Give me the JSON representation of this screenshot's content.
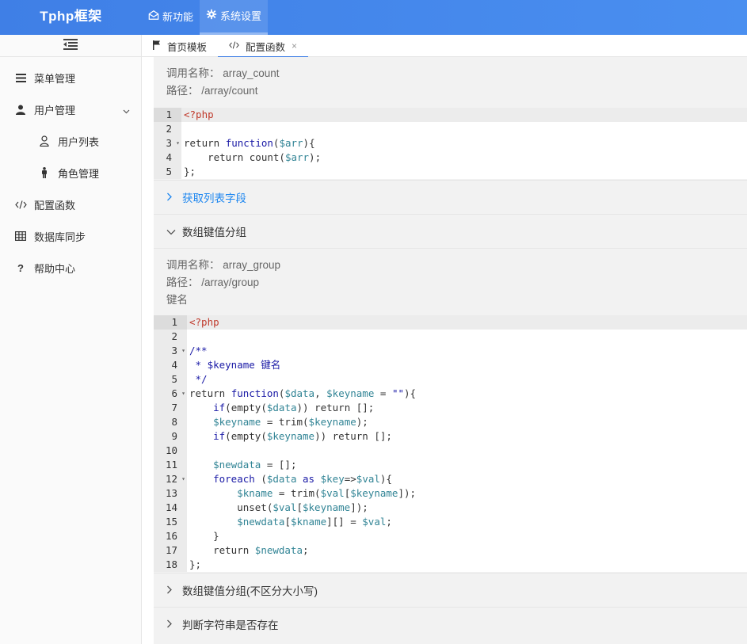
{
  "brand": "Tphp框架",
  "topnav": [
    {
      "label": "新功能",
      "icon": "envelope-open-icon"
    },
    {
      "label": "系统设置",
      "icon": "gear-icon"
    }
  ],
  "sidebar": {
    "items": [
      {
        "label": "菜单管理",
        "icon": "menu-lines-icon"
      },
      {
        "label": "用户管理",
        "icon": "user-icon"
      },
      {
        "label": "用户列表",
        "icon": "user-outline-icon"
      },
      {
        "label": "角色管理",
        "icon": "person-standing-icon"
      },
      {
        "label": "配置函数",
        "icon": "code-icon"
      },
      {
        "label": "数据库同步",
        "icon": "table-icon"
      },
      {
        "label": "帮助中心",
        "icon": "question-icon"
      }
    ]
  },
  "tabs": [
    {
      "label": "首页模板",
      "icon": "flag-icon"
    },
    {
      "label": "配置函数",
      "icon": "code-icon",
      "close": "×"
    }
  ],
  "block1": {
    "call_label": "调用名称：",
    "call_name": "array_count",
    "path_label": "路径：",
    "path": "/array/count"
  },
  "sections": {
    "s1": "获取列表字段",
    "s2": "数组键值分组",
    "s3": "数组键值分组(不区分大小写)",
    "s4": "判断字符串是否存在"
  },
  "block2": {
    "call_label": "调用名称：",
    "call_name": "array_group",
    "path_label": "路径：",
    "path": "/array/group",
    "param": "键名"
  },
  "code1_lines": [
    "1",
    "2",
    "3",
    "4",
    "5"
  ],
  "code2_lines": [
    "1",
    "2",
    "3",
    "4",
    "5",
    "6",
    "7",
    "8",
    "9",
    "10",
    "11",
    "12",
    "13",
    "14",
    "15",
    "16",
    "17",
    "18"
  ],
  "colors": {
    "topbar": "#3f7fe6",
    "link": "#1e87f0"
  }
}
